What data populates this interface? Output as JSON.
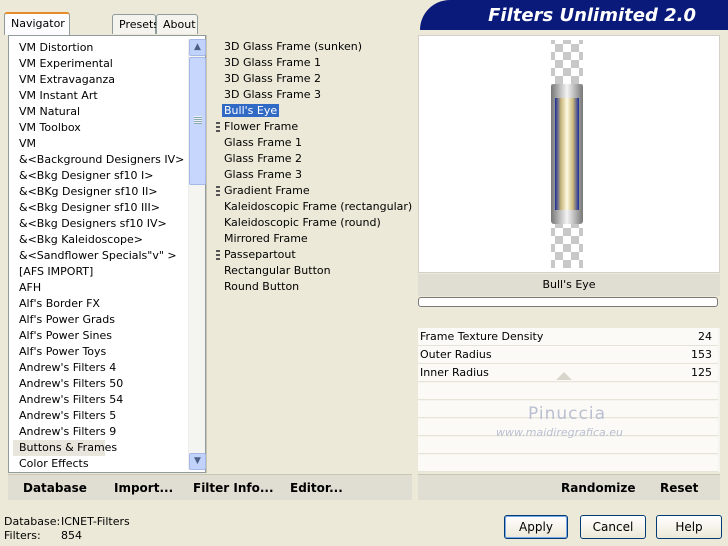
{
  "tabs": [
    "Navigator",
    "Presets",
    "About"
  ],
  "title": "Filters Unlimited 2.0",
  "categories": [
    "VM Distortion",
    "VM Experimental",
    "VM Extravaganza",
    "VM Instant Art",
    "VM Natural",
    "VM Toolbox",
    "VM",
    "&<Background Designers IV>",
    "&<Bkg Designer sf10 I>",
    "&<BKg Designer sf10 II>",
    "&<Bkg Designer sf10 III>",
    "&<Bkg Designers sf10 IV>",
    "&<Bkg Kaleidoscope>",
    "&<Sandflower Specials\"v\" >",
    "[AFS IMPORT]",
    "AFH",
    "Alf's Border FX",
    "Alf's Power Grads",
    "Alf's Power Sines",
    "Alf's Power Toys",
    "Andrew's Filters 4",
    "Andrew's Filters 50",
    "Andrew's Filters 54",
    "Andrew's Filters 5",
    "Andrew's Filters 9",
    "Buttons & Frames",
    "Color Effects"
  ],
  "selected_category": "Buttons & Frames",
  "filters": [
    {
      "label": "3D Glass Frame (sunken)"
    },
    {
      "label": "3D Glass Frame 1"
    },
    {
      "label": "3D Glass Frame 2"
    },
    {
      "label": "3D Glass Frame 3"
    },
    {
      "label": "Bull's Eye"
    },
    {
      "label": "Flower Frame"
    },
    {
      "label": "Glass Frame 1"
    },
    {
      "label": "Glass Frame 2"
    },
    {
      "label": "Glass Frame 3"
    },
    {
      "label": "Gradient Frame"
    },
    {
      "label": "Kaleidoscopic Frame (rectangular)"
    },
    {
      "label": "Kaleidoscopic Frame (round)"
    },
    {
      "label": "Mirrored Frame"
    },
    {
      "label": "Passepartout"
    },
    {
      "label": "Rectangular Button"
    },
    {
      "label": "Round Button"
    }
  ],
  "selected_filter": "Bull's Eye",
  "preview_caption": "Bull's Eye",
  "params": [
    {
      "label": "Frame Texture Density",
      "value": "24"
    },
    {
      "label": "Outer Radius",
      "value": "153"
    },
    {
      "label": "Inner Radius",
      "value": "125"
    }
  ],
  "watermark": {
    "name": "Pinuccia",
    "site": "www.maidiregrafica.eu"
  },
  "toolbar_left": [
    "Database",
    "Import...",
    "Filter Info...",
    "Editor..."
  ],
  "toolbar_right": [
    "Randomize",
    "Reset"
  ],
  "status": {
    "database_label": "Database:",
    "database_value": "ICNET-Filters",
    "filters_label": "Filters:",
    "filters_value": "854"
  },
  "buttons": {
    "apply": "Apply",
    "cancel": "Cancel",
    "help": "Help"
  },
  "icons": {
    "scroll_up": "chevron-up-icon",
    "scroll_down": "chevron-down-icon"
  },
  "colors": {
    "banner": "#0a1a7a",
    "selection": "#316ac5",
    "active_tab": "#e68b2c"
  }
}
